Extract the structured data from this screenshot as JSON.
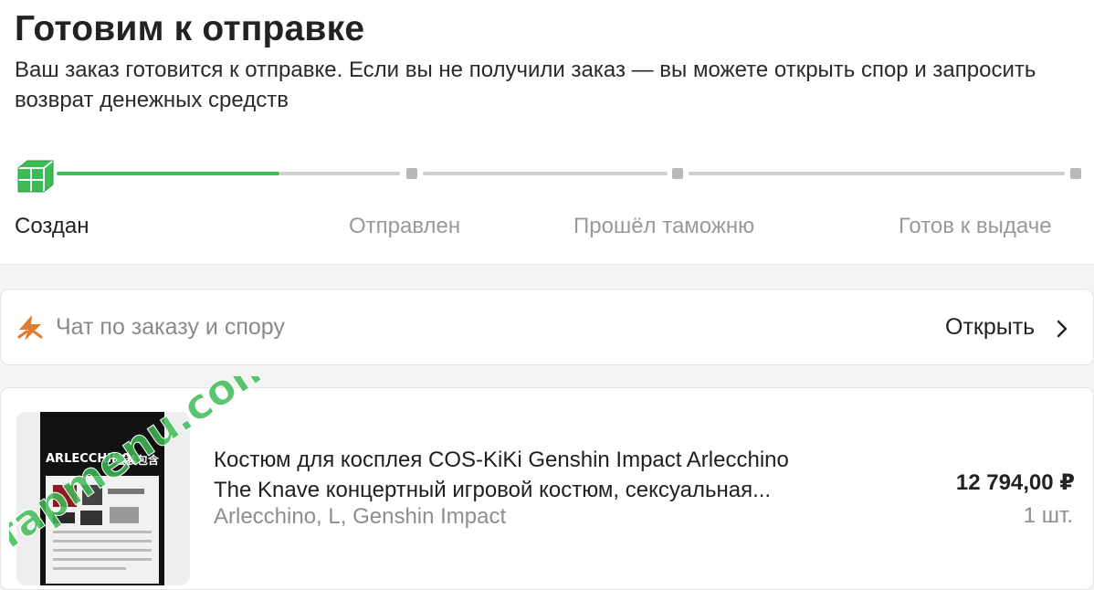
{
  "header": {
    "title": "Готовим к отправке",
    "description": "Ваш заказ готовится к отправке. Если вы не получили заказ — вы можете открыть спор и запросить возврат денежных средств"
  },
  "progress": {
    "current_stage_index": 0,
    "current_segment_fill": 0.55,
    "active_color": "#3dbb55",
    "inactive_color": "#cfcfcf",
    "stages": [
      {
        "label": "Создан"
      },
      {
        "label": "Отправлен"
      },
      {
        "label": "Прошёл таможню"
      },
      {
        "label": "Готов к выдаче"
      }
    ]
  },
  "chat": {
    "icon": "lightning-chat-icon",
    "label": "Чат по заказу и спору",
    "action_label": "Открыть",
    "action_icon": "chevron-right-icon",
    "icon_color": "#e07a2c"
  },
  "product": {
    "image_text": {
      "name": "ARLECCHINO",
      "tag": "套装包含"
    },
    "title_line1": "Костюм для косплея COS-KiKi Genshin Impact Arlecchino",
    "title_line2": "The Knave концертный игровой костюм, сексуальная...",
    "variant": "Arlecchino, L, Genshin Impact",
    "price": "12 794,00 ₽",
    "quantity": "1 шт."
  },
  "watermark": {
    "text": "fapmenu.com",
    "color": "#3dbb55"
  }
}
